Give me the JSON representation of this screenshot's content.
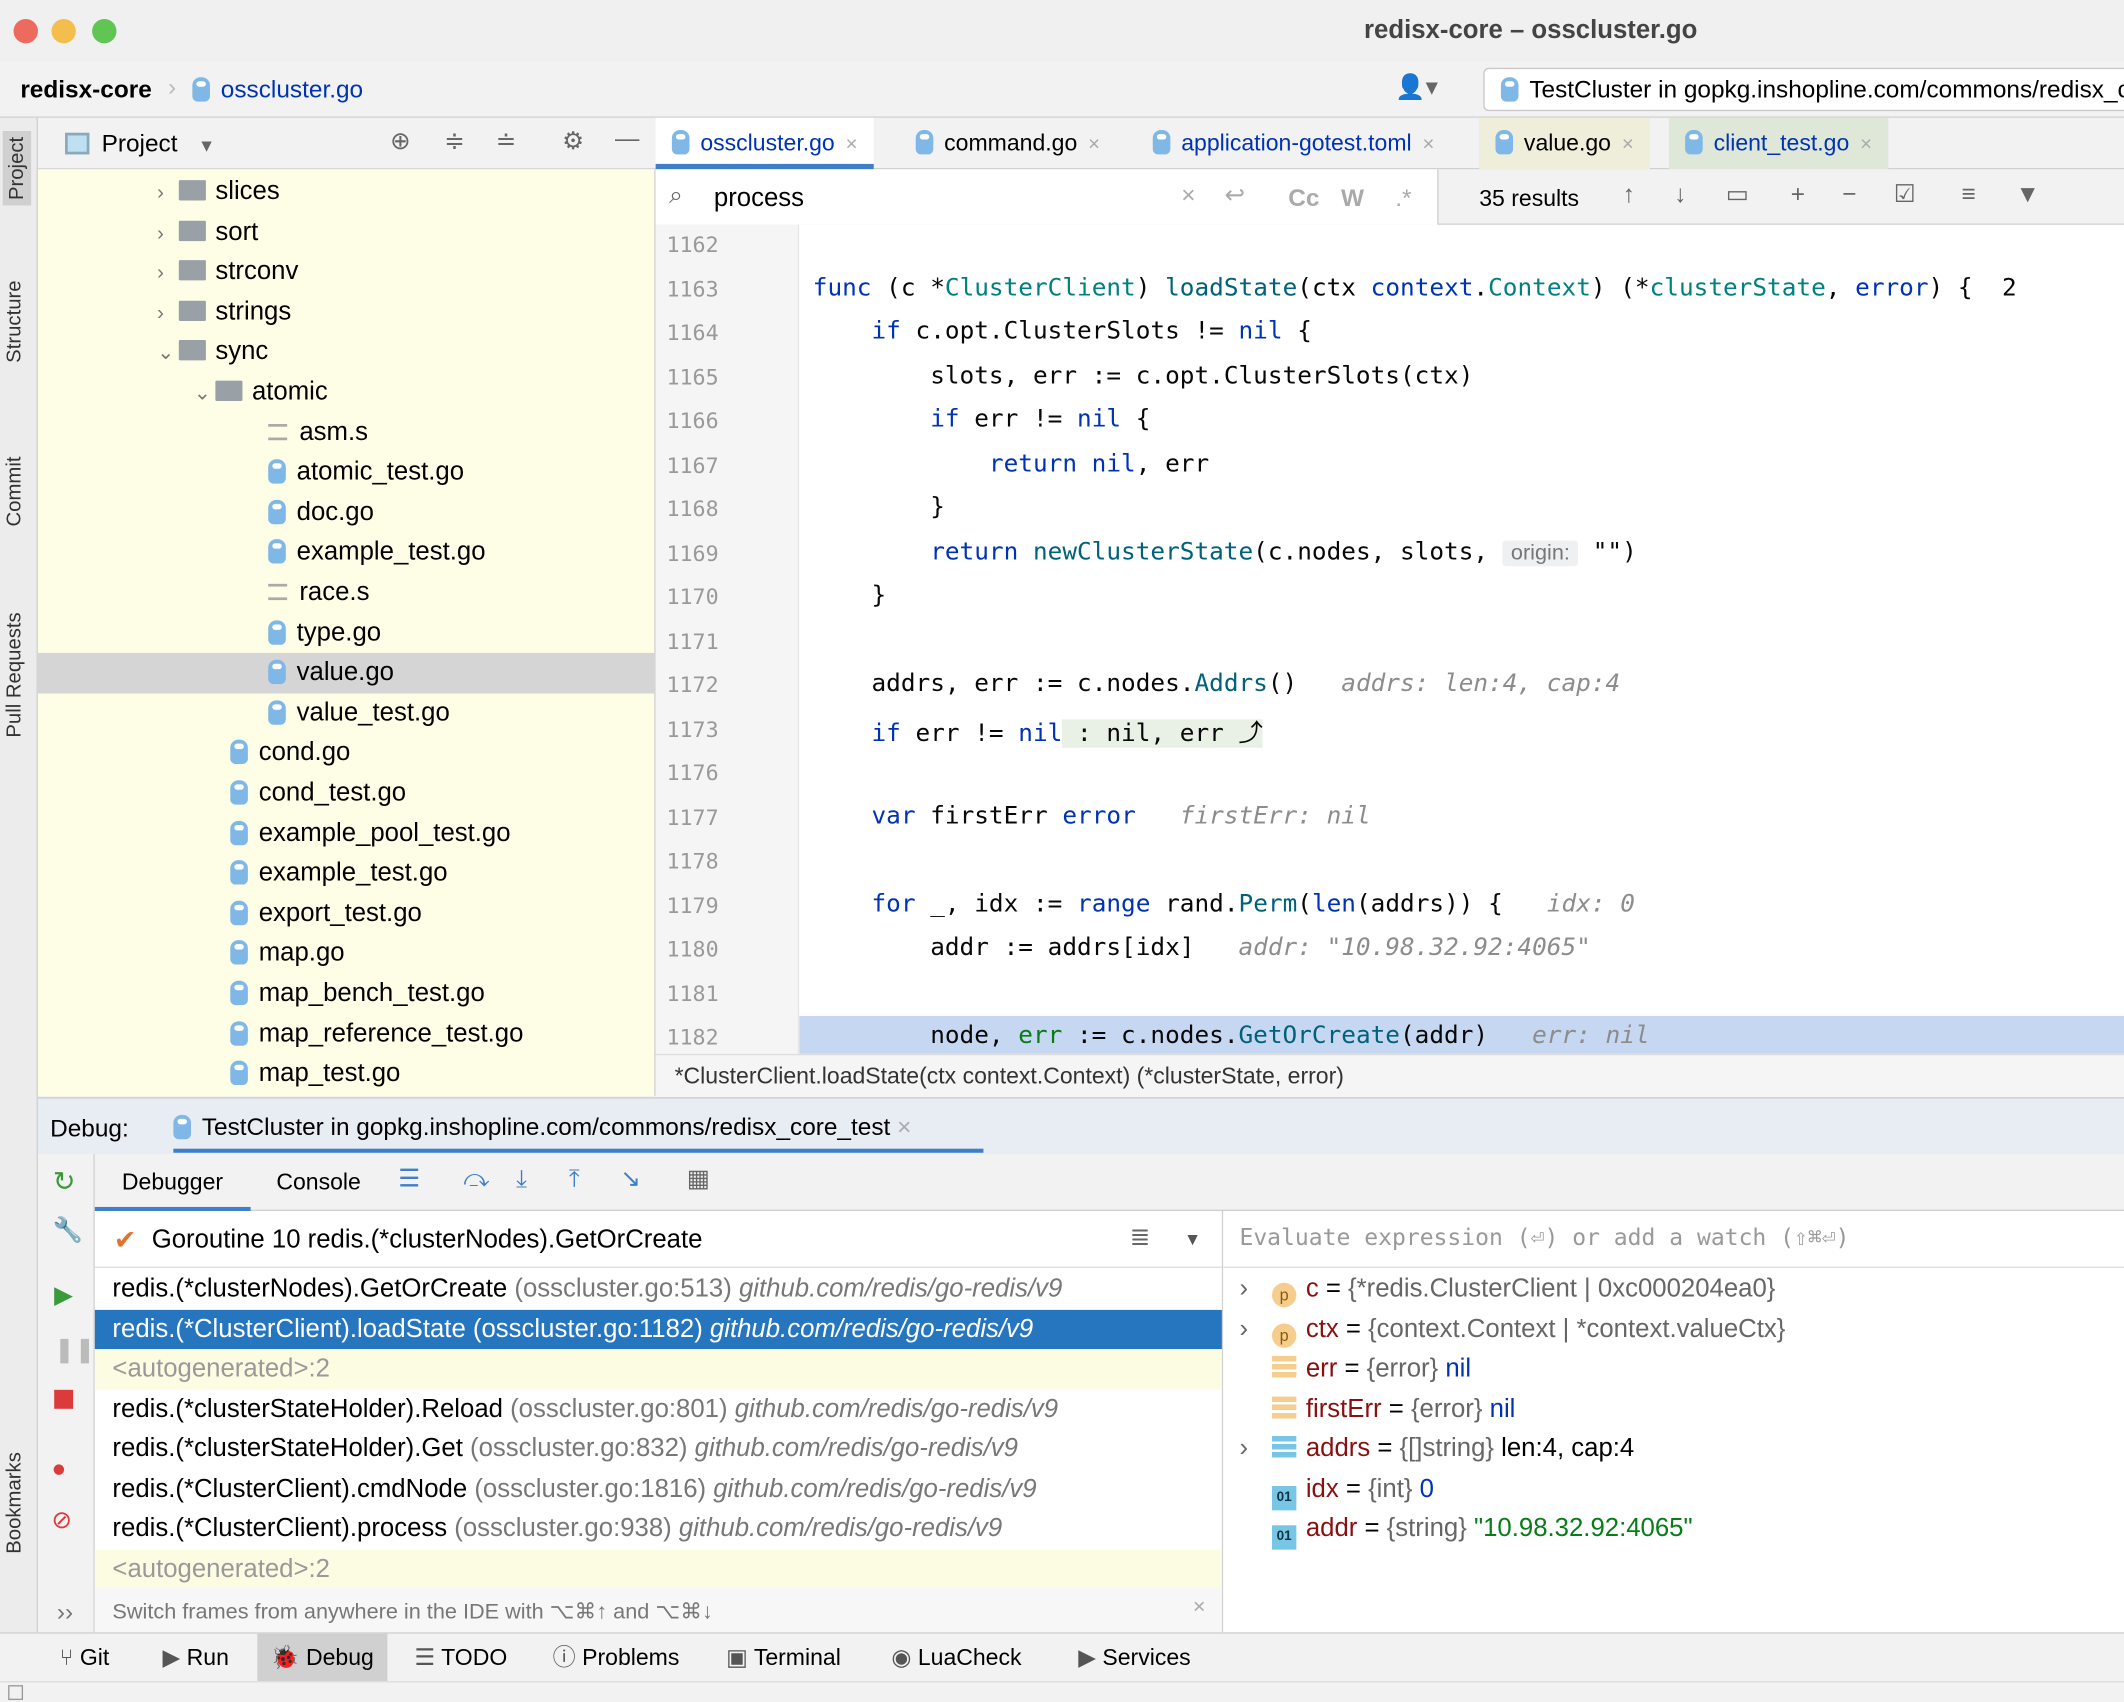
{
  "window": {
    "title": "redisx-core – osscluster.go"
  },
  "navbar": {
    "project": "redisx-core",
    "file": "osscluster.go",
    "run_config": "TestCluster in gopkg.inshopline.com/commons/redisx_c"
  },
  "left_stripe": [
    "Project",
    "Structure",
    "Commit",
    "Pull Requests",
    "Bookmarks"
  ],
  "project_panel": {
    "title": "Project",
    "tree": [
      {
        "label": "slices",
        "kind": "folder",
        "depth": 0,
        "chev": "›"
      },
      {
        "label": "sort",
        "kind": "folder",
        "depth": 0,
        "chev": "›"
      },
      {
        "label": "strconv",
        "kind": "folder",
        "depth": 0,
        "chev": "›"
      },
      {
        "label": "strings",
        "kind": "folder",
        "depth": 0,
        "chev": "›"
      },
      {
        "label": "sync",
        "kind": "folder",
        "depth": 0,
        "chev": "⌄"
      },
      {
        "label": "atomic",
        "kind": "folder",
        "depth": 1,
        "chev": "⌄"
      },
      {
        "label": "asm.s",
        "kind": "asm",
        "depth": 2
      },
      {
        "label": "atomic_test.go",
        "kind": "go",
        "depth": 2
      },
      {
        "label": "doc.go",
        "kind": "go",
        "depth": 2
      },
      {
        "label": "example_test.go",
        "kind": "go",
        "depth": 2
      },
      {
        "label": "race.s",
        "kind": "asm",
        "depth": 2
      },
      {
        "label": "type.go",
        "kind": "go",
        "depth": 2
      },
      {
        "label": "value.go",
        "kind": "go",
        "depth": 2,
        "selected": true
      },
      {
        "label": "value_test.go",
        "kind": "go",
        "depth": 2
      },
      {
        "label": "cond.go",
        "kind": "go",
        "depth": 1
      },
      {
        "label": "cond_test.go",
        "kind": "go",
        "depth": 1
      },
      {
        "label": "example_pool_test.go",
        "kind": "go",
        "depth": 1
      },
      {
        "label": "example_test.go",
        "kind": "go",
        "depth": 1
      },
      {
        "label": "export_test.go",
        "kind": "go",
        "depth": 1
      },
      {
        "label": "map.go",
        "kind": "go",
        "depth": 1
      },
      {
        "label": "map_bench_test.go",
        "kind": "go",
        "depth": 1
      },
      {
        "label": "map_reference_test.go",
        "kind": "go",
        "depth": 1
      },
      {
        "label": "map_test.go",
        "kind": "go",
        "depth": 1
      }
    ]
  },
  "editor": {
    "tabs": [
      {
        "label": "osscluster.go",
        "active": true,
        "color": "#0033b3"
      },
      {
        "label": "command.go",
        "color": "#000000"
      },
      {
        "label": "application-gotest.toml",
        "color": "#0033b3"
      },
      {
        "label": "value.go",
        "color": "#000000",
        "bg": "#eeeedb"
      },
      {
        "label": "client_test.go",
        "color": "#0033b3",
        "bg": "#dfe8d8"
      }
    ],
    "search": {
      "query": "process",
      "results": "35 results",
      "cc": "Cc",
      "w": "W",
      "regex": ".*"
    },
    "lines": [
      {
        "n": "1162",
        "t": []
      },
      {
        "n": "1163",
        "t": [
          [
            "func ",
            "kw"
          ],
          [
            "(c *",
            ""
          ],
          [
            "ClusterClient",
            "ty"
          ],
          [
            ") ",
            ""
          ],
          [
            "loadState",
            "fn"
          ],
          [
            "(ctx ",
            ""
          ],
          [
            "context",
            "tp"
          ],
          [
            ".",
            ""
          ],
          [
            "Context",
            "ty"
          ],
          [
            ") (*",
            ""
          ],
          [
            "clusterState",
            "ty"
          ],
          [
            ", ",
            ""
          ],
          [
            "error",
            "kw"
          ],
          [
            ") {  2",
            ""
          ]
        ]
      },
      {
        "n": "1164",
        "t": [
          [
            "    if ",
            "kw"
          ],
          [
            "c",
            ""
          ],
          [
            ".opt.ClusterSlots != ",
            ""
          ],
          [
            "nil",
            "kw"
          ],
          [
            " {",
            ""
          ]
        ]
      },
      {
        "n": "1165",
        "t": [
          [
            "        slots, err := ",
            ""
          ],
          [
            "c",
            ""
          ],
          [
            ".opt.ClusterSlots(ctx)",
            ""
          ]
        ]
      },
      {
        "n": "1166",
        "t": [
          [
            "        if ",
            "kw"
          ],
          [
            "err != ",
            ""
          ],
          [
            "nil",
            "kw"
          ],
          [
            " {",
            ""
          ]
        ]
      },
      {
        "n": "1167",
        "t": [
          [
            "            return ",
            "kw"
          ],
          [
            "nil",
            "kw"
          ],
          [
            ", err",
            ""
          ]
        ]
      },
      {
        "n": "1168",
        "t": [
          [
            "        }",
            ""
          ]
        ]
      },
      {
        "n": "1169",
        "t": [
          [
            "        return ",
            "kw"
          ],
          [
            "newClusterState",
            "fn"
          ],
          [
            "(",
            ""
          ],
          [
            "c",
            ""
          ],
          [
            ".nodes, slots, ",
            ""
          ],
          [
            "origin:",
            "ph"
          ],
          [
            " \"\")",
            ""
          ]
        ]
      },
      {
        "n": "1170",
        "t": [
          [
            "    }",
            ""
          ]
        ]
      },
      {
        "n": "1171",
        "t": []
      },
      {
        "n": "1172",
        "t": [
          [
            "    addrs, err := ",
            ""
          ],
          [
            "c",
            ""
          ],
          [
            ".nodes.",
            ""
          ],
          [
            "Addrs",
            "fn"
          ],
          [
            "()   ",
            ""
          ],
          [
            "addrs: len:4, cap:4",
            "hint"
          ]
        ]
      },
      {
        "n": "1173",
        "t": [
          [
            "    if ",
            "kw"
          ],
          [
            "err != ",
            ""
          ],
          [
            "nil",
            "kw"
          ],
          [
            " : nil, err ⤴",
            "fold"
          ]
        ]
      },
      {
        "n": "1176",
        "t": []
      },
      {
        "n": "1177",
        "t": [
          [
            "    var ",
            "kw"
          ],
          [
            "firstErr ",
            ""
          ],
          [
            "error",
            "kw"
          ],
          [
            "   ",
            ""
          ],
          [
            "firstErr: nil",
            "hint"
          ]
        ]
      },
      {
        "n": "1178",
        "t": []
      },
      {
        "n": "1179",
        "t": [
          [
            "    for ",
            "kw"
          ],
          [
            "_, idx := ",
            ""
          ],
          [
            "range ",
            "kw"
          ],
          [
            "rand",
            ""
          ],
          [
            ".",
            ""
          ],
          [
            "Perm",
            "fn"
          ],
          [
            "(",
            ""
          ],
          [
            "len",
            "kw"
          ],
          [
            "(addrs)) {   ",
            ""
          ],
          [
            "idx: 0",
            "hint"
          ]
        ]
      },
      {
        "n": "1180",
        "t": [
          [
            "        addr := addrs[idx]   ",
            ""
          ],
          [
            "addr: \"10.98.32.92:4065\"",
            "hint"
          ]
        ]
      },
      {
        "n": "1181",
        "t": []
      },
      {
        "n": "1182",
        "t": [
          [
            "        node, ",
            ""
          ],
          [
            "err",
            "str"
          ],
          [
            " := ",
            ""
          ],
          [
            "c",
            ""
          ],
          [
            ".nodes.",
            ""
          ],
          [
            "GetOrCreate",
            "fn"
          ],
          [
            "(addr)   ",
            ""
          ],
          [
            "err: nil",
            "hint"
          ]
        ],
        "current": true
      }
    ],
    "breadcrumb": "*ClusterClient.loadState(ctx context.Context) (*clusterState, error)"
  },
  "debug": {
    "label": "Debug:",
    "session": "TestCluster in gopkg.inshopline.com/commons/redisx_core_test",
    "tabs": [
      "Debugger",
      "Console"
    ],
    "goroutine": "Goroutine 10 redis.(*clusterNodes).GetOrCreate",
    "frames": [
      {
        "fn": "redis.(*clusterNodes).GetOrCreate",
        "loc": "(osscluster.go:513)",
        "pkg": "github.com/redis/go-redis/v9"
      },
      {
        "fn": "redis.(*ClusterClient).loadState",
        "loc": "(osscluster.go:1182)",
        "pkg": "github.com/redis/go-redis/v9",
        "selected": true
      },
      {
        "fn": "<autogenerated>:2",
        "auto": true
      },
      {
        "fn": "redis.(*clusterStateHolder).Reload",
        "loc": "(osscluster.go:801)",
        "pkg": "github.com/redis/go-redis/v9"
      },
      {
        "fn": "redis.(*clusterStateHolder).Get",
        "loc": "(osscluster.go:832)",
        "pkg": "github.com/redis/go-redis/v9"
      },
      {
        "fn": "redis.(*ClusterClient).cmdNode",
        "loc": "(osscluster.go:1816)",
        "pkg": "github.com/redis/go-redis/v9"
      },
      {
        "fn": "redis.(*ClusterClient).process",
        "loc": "(osscluster.go:938)",
        "pkg": "github.com/redis/go-redis/v9"
      },
      {
        "fn": "<autogenerated>:2",
        "auto": true
      }
    ],
    "frames_hint": "Switch frames from anywhere in the IDE with ⌥⌘↑ and ⌥⌘↓",
    "evaluate_placeholder": "Evaluate expression (⏎) or add a watch (⇧⌘⏎)",
    "variables": [
      {
        "name": "c",
        "type": "{*redis.ClusterClient | 0xc000204ea0}",
        "value": "",
        "icon": "p",
        "expand": true,
        "vc": "vt"
      },
      {
        "name": "ctx",
        "type": "{context.Context | *context.valueCtx}",
        "value": "",
        "icon": "p",
        "expand": true,
        "vc": "vt"
      },
      {
        "name": "err",
        "type": "{error}",
        "value": "nil",
        "icon": "field",
        "vc": "vb"
      },
      {
        "name": "firstErr",
        "type": "{error}",
        "value": "nil",
        "icon": "field",
        "vc": "vb"
      },
      {
        "name": "addrs",
        "type": "{[]string}",
        "value": "len:4, cap:4",
        "icon": "list",
        "expand": true,
        "vc": ""
      },
      {
        "name": "idx",
        "type": "{int}",
        "value": "0",
        "icon": "01",
        "vc": "vb"
      },
      {
        "name": "addr",
        "type": "{string}",
        "value": "\"10.98.32.92:4065\"",
        "icon": "01",
        "vc": "vg"
      }
    ]
  },
  "bottom_bar": [
    "Git",
    "Run",
    "Debug",
    "TODO",
    "Problems",
    "Terminal",
    "LuaCheck",
    "Services"
  ]
}
